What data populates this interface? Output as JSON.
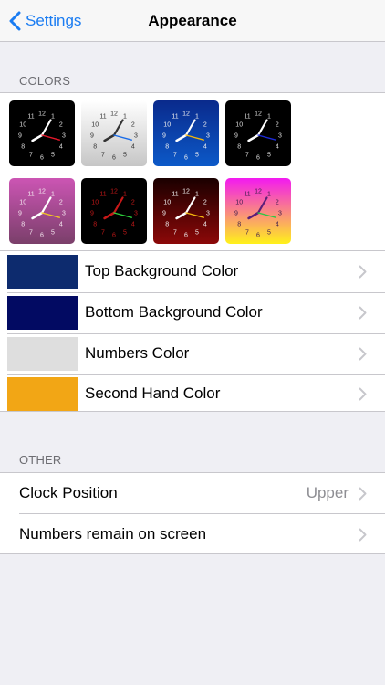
{
  "nav": {
    "back_label": "Settings",
    "title": "Appearance"
  },
  "colors_section": {
    "header": "COLORS",
    "clock_themes": [
      {
        "bg_top": "#000000",
        "bg_bottom": "#000000",
        "numbers": "#dddddd",
        "hands": "#ffffff",
        "second": "#e8172b"
      },
      {
        "bg_top": "#ffffff",
        "bg_bottom": "#c6c6c6",
        "numbers": "#333333",
        "hands": "#333333",
        "second": "#1a6ce8"
      },
      {
        "bg_top": "#0a2a8c",
        "bg_bottom": "#0c59c8",
        "numbers": "#f0f0f0",
        "hands": "#ffffff",
        "second": "#f0b40c"
      },
      {
        "bg_top": "#000000",
        "bg_bottom": "#000000",
        "numbers": "#dddddd",
        "hands": "#ffffff",
        "second": "#1c2ad8"
      },
      {
        "bg_top": "#cc55b4",
        "bg_bottom": "#7a3f6a",
        "numbers": "#f5e8f0",
        "hands": "#ffffff",
        "second": "#f3c523"
      },
      {
        "bg_top": "#000000",
        "bg_bottom": "#000000",
        "numbers": "#c01818",
        "hands": "#c81818",
        "second": "#2ccd3b"
      },
      {
        "bg_top": "#1a0000",
        "bg_bottom": "#8c0808",
        "numbers": "#f0f0f0",
        "hands": "#ffffff",
        "second": "#f0b40c"
      },
      {
        "bg_top": "#f21af0",
        "bg_bottom": "#fff21a",
        "numbers": "#3a1a4a",
        "hands": "#5a1f7a",
        "second": "#2bc844"
      }
    ],
    "color_rows": [
      {
        "label": "Top Background Color",
        "color": "#0d2b6e"
      },
      {
        "label": "Bottom Background Color",
        "color": "#020a62"
      },
      {
        "label": "Numbers Color",
        "color": "#dedede"
      },
      {
        "label": "Second Hand Color",
        "color": "#f2a615"
      }
    ]
  },
  "other_section": {
    "header": "OTHER",
    "rows": [
      {
        "label": "Clock Position",
        "value": "Upper"
      },
      {
        "label": "Numbers remain on screen",
        "value": ""
      }
    ]
  },
  "icons": {
    "back": "chevron-left-icon",
    "row_arrow": "chevron-right-icon"
  }
}
